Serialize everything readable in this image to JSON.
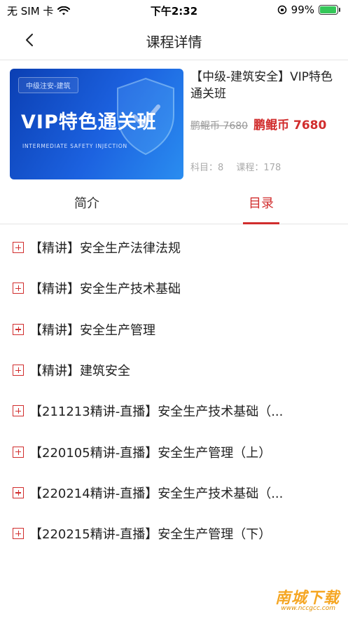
{
  "status_bar": {
    "carrier": "无 SIM 卡",
    "time": "下午2:32",
    "battery_percent": "99%",
    "battery_level": 0.99,
    "icons": [
      "wifi-icon",
      "orientation-lock-icon",
      "battery-icon"
    ]
  },
  "nav": {
    "title": "课程详情",
    "back_icon": "chevron-left-icon"
  },
  "course": {
    "cover": {
      "tag": "中级注安-建筑",
      "headline": "VIP特色通关班",
      "subtitle": "INTERMEDIATE SAFETY INJECTION"
    },
    "name": "【中级-建筑安全】VIP特色通关班",
    "original_price": "鹏鲲币 7680",
    "price": "鹏鲲币 7680",
    "subjects": "科目：8",
    "lessons": "课程：178"
  },
  "tabs": [
    {
      "label": "简介",
      "active": false
    },
    {
      "label": "目录",
      "active": true
    }
  ],
  "catalog": [
    "【精讲】安全生产法律法规",
    "【精讲】安全生产技术基础",
    "【精讲】安全生产管理",
    "【精讲】建筑安全",
    "【211213精讲-直播】安全生产技术基础（...",
    "【220105精讲-直播】安全生产管理（上）",
    "【220214精讲-直播】安全生产技术基础（...",
    "【220215精讲-直播】安全生产管理（下）"
  ],
  "watermark": {
    "main": "南城下载",
    "url": "www.nccgcc.com"
  },
  "colors": {
    "accent": "#d12d2d",
    "cover_blue": "#1c62e0",
    "muted": "#999999"
  }
}
